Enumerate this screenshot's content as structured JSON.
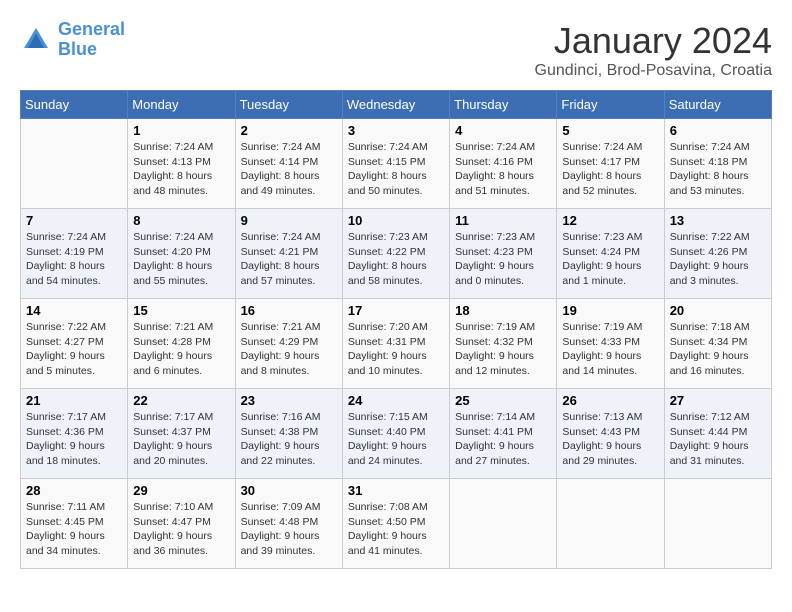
{
  "header": {
    "logo_line1": "General",
    "logo_line2": "Blue",
    "title": "January 2024",
    "subtitle": "Gundinci, Brod-Posavina, Croatia"
  },
  "weekdays": [
    "Sunday",
    "Monday",
    "Tuesday",
    "Wednesday",
    "Thursday",
    "Friday",
    "Saturday"
  ],
  "weeks": [
    [
      {
        "day": "",
        "info": ""
      },
      {
        "day": "1",
        "info": "Sunrise: 7:24 AM\nSunset: 4:13 PM\nDaylight: 8 hours\nand 48 minutes."
      },
      {
        "day": "2",
        "info": "Sunrise: 7:24 AM\nSunset: 4:14 PM\nDaylight: 8 hours\nand 49 minutes."
      },
      {
        "day": "3",
        "info": "Sunrise: 7:24 AM\nSunset: 4:15 PM\nDaylight: 8 hours\nand 50 minutes."
      },
      {
        "day": "4",
        "info": "Sunrise: 7:24 AM\nSunset: 4:16 PM\nDaylight: 8 hours\nand 51 minutes."
      },
      {
        "day": "5",
        "info": "Sunrise: 7:24 AM\nSunset: 4:17 PM\nDaylight: 8 hours\nand 52 minutes."
      },
      {
        "day": "6",
        "info": "Sunrise: 7:24 AM\nSunset: 4:18 PM\nDaylight: 8 hours\nand 53 minutes."
      }
    ],
    [
      {
        "day": "7",
        "info": "Sunrise: 7:24 AM\nSunset: 4:19 PM\nDaylight: 8 hours\nand 54 minutes."
      },
      {
        "day": "8",
        "info": "Sunrise: 7:24 AM\nSunset: 4:20 PM\nDaylight: 8 hours\nand 55 minutes."
      },
      {
        "day": "9",
        "info": "Sunrise: 7:24 AM\nSunset: 4:21 PM\nDaylight: 8 hours\nand 57 minutes."
      },
      {
        "day": "10",
        "info": "Sunrise: 7:23 AM\nSunset: 4:22 PM\nDaylight: 8 hours\nand 58 minutes."
      },
      {
        "day": "11",
        "info": "Sunrise: 7:23 AM\nSunset: 4:23 PM\nDaylight: 9 hours\nand 0 minutes."
      },
      {
        "day": "12",
        "info": "Sunrise: 7:23 AM\nSunset: 4:24 PM\nDaylight: 9 hours\nand 1 minute."
      },
      {
        "day": "13",
        "info": "Sunrise: 7:22 AM\nSunset: 4:26 PM\nDaylight: 9 hours\nand 3 minutes."
      }
    ],
    [
      {
        "day": "14",
        "info": "Sunrise: 7:22 AM\nSunset: 4:27 PM\nDaylight: 9 hours\nand 5 minutes."
      },
      {
        "day": "15",
        "info": "Sunrise: 7:21 AM\nSunset: 4:28 PM\nDaylight: 9 hours\nand 6 minutes."
      },
      {
        "day": "16",
        "info": "Sunrise: 7:21 AM\nSunset: 4:29 PM\nDaylight: 9 hours\nand 8 minutes."
      },
      {
        "day": "17",
        "info": "Sunrise: 7:20 AM\nSunset: 4:31 PM\nDaylight: 9 hours\nand 10 minutes."
      },
      {
        "day": "18",
        "info": "Sunrise: 7:19 AM\nSunset: 4:32 PM\nDaylight: 9 hours\nand 12 minutes."
      },
      {
        "day": "19",
        "info": "Sunrise: 7:19 AM\nSunset: 4:33 PM\nDaylight: 9 hours\nand 14 minutes."
      },
      {
        "day": "20",
        "info": "Sunrise: 7:18 AM\nSunset: 4:34 PM\nDaylight: 9 hours\nand 16 minutes."
      }
    ],
    [
      {
        "day": "21",
        "info": "Sunrise: 7:17 AM\nSunset: 4:36 PM\nDaylight: 9 hours\nand 18 minutes."
      },
      {
        "day": "22",
        "info": "Sunrise: 7:17 AM\nSunset: 4:37 PM\nDaylight: 9 hours\nand 20 minutes."
      },
      {
        "day": "23",
        "info": "Sunrise: 7:16 AM\nSunset: 4:38 PM\nDaylight: 9 hours\nand 22 minutes."
      },
      {
        "day": "24",
        "info": "Sunrise: 7:15 AM\nSunset: 4:40 PM\nDaylight: 9 hours\nand 24 minutes."
      },
      {
        "day": "25",
        "info": "Sunrise: 7:14 AM\nSunset: 4:41 PM\nDaylight: 9 hours\nand 27 minutes."
      },
      {
        "day": "26",
        "info": "Sunrise: 7:13 AM\nSunset: 4:43 PM\nDaylight: 9 hours\nand 29 minutes."
      },
      {
        "day": "27",
        "info": "Sunrise: 7:12 AM\nSunset: 4:44 PM\nDaylight: 9 hours\nand 31 minutes."
      }
    ],
    [
      {
        "day": "28",
        "info": "Sunrise: 7:11 AM\nSunset: 4:45 PM\nDaylight: 9 hours\nand 34 minutes."
      },
      {
        "day": "29",
        "info": "Sunrise: 7:10 AM\nSunset: 4:47 PM\nDaylight: 9 hours\nand 36 minutes."
      },
      {
        "day": "30",
        "info": "Sunrise: 7:09 AM\nSunset: 4:48 PM\nDaylight: 9 hours\nand 39 minutes."
      },
      {
        "day": "31",
        "info": "Sunrise: 7:08 AM\nSunset: 4:50 PM\nDaylight: 9 hours\nand 41 minutes."
      },
      {
        "day": "",
        "info": ""
      },
      {
        "day": "",
        "info": ""
      },
      {
        "day": "",
        "info": ""
      }
    ]
  ]
}
